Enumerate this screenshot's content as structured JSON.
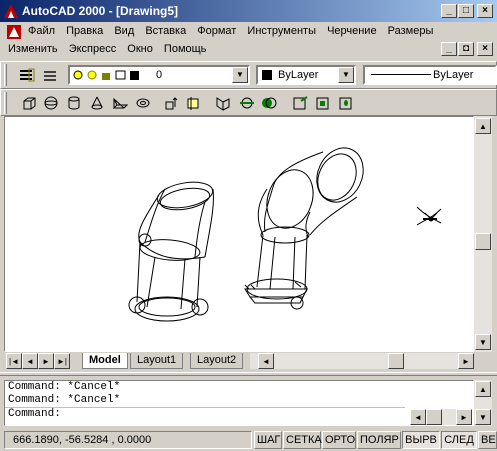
{
  "window": {
    "title": "AutoCAD 2000 - [Drawing5]"
  },
  "menu1": [
    "Файл",
    "Правка",
    "Вид",
    "Вставка",
    "Формат",
    "Инструменты",
    "Черчение",
    "Размеры"
  ],
  "menu2": [
    "Изменить",
    "Экспресс",
    "Окно",
    "Помощь"
  ],
  "layer": {
    "current": "0"
  },
  "color": {
    "value": "ByLayer"
  },
  "linetype": {
    "value": "ByLayer"
  },
  "tabs": [
    "Model",
    "Layout1",
    "Layout2"
  ],
  "command_lines": [
    "Command: *Cancel*",
    "Command: *Cancel*",
    "Command:"
  ],
  "status": {
    "coords": "666.1890, -56.5284 , 0.0000",
    "buttons": [
      "ШАГ",
      "СЕТКА",
      "ОРТО",
      "ПОЛЯР",
      "ВЫРВ",
      "СЛЕД",
      "ВЕ"
    ]
  }
}
